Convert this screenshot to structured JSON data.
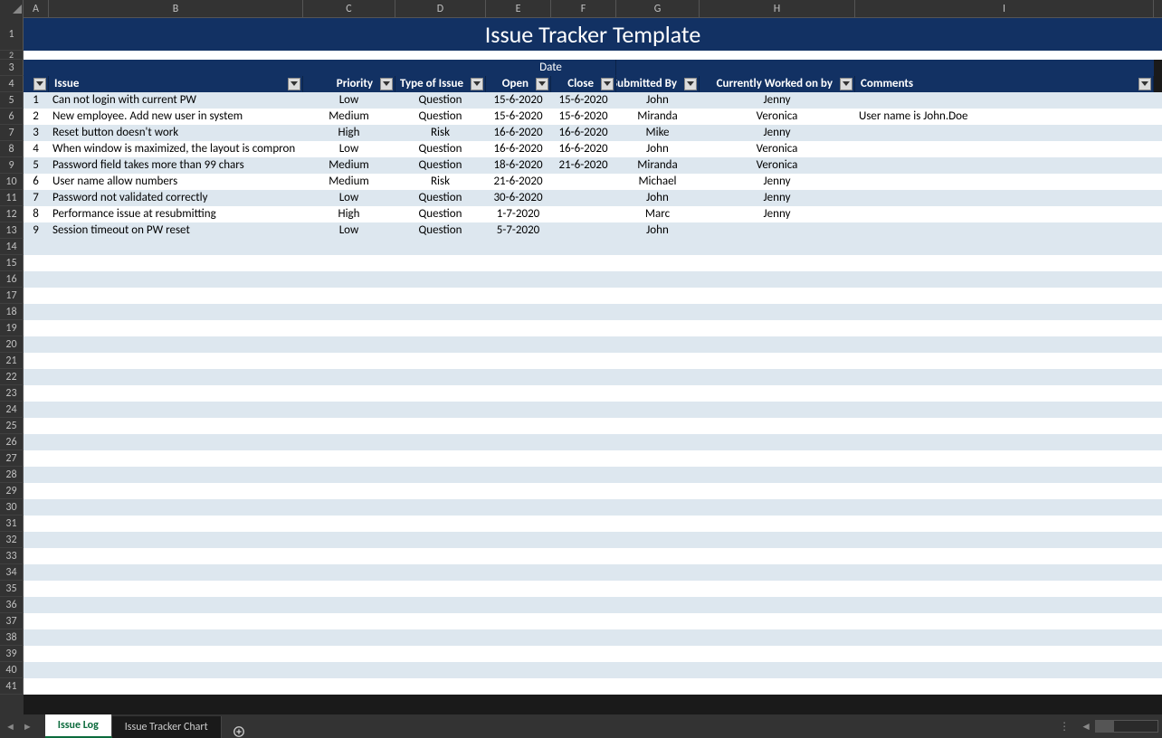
{
  "columns": [
    "A",
    "B",
    "C",
    "D",
    "E",
    "F",
    "G",
    "H",
    "I"
  ],
  "title": "Issue Tracker Template",
  "date_group_label": "Date",
  "headers": {
    "id": "",
    "issue": "Issue",
    "priority": "Priority",
    "type": "Type of Issue",
    "open": "Open",
    "close": "Close",
    "submitted_by": "Submitted By",
    "worked_by": "Currently Worked on by",
    "comments": "Comments"
  },
  "rows": [
    {
      "n": "1",
      "issue": "Can not login with current PW",
      "priority": "Low",
      "type": "Question",
      "open": "15-6-2020",
      "close": "15-6-2020",
      "submitted_by": "John",
      "worked_by": "Jenny",
      "comments": ""
    },
    {
      "n": "2",
      "issue": "New employee. Add new user in system",
      "priority": "Medium",
      "type": "Question",
      "open": "15-6-2020",
      "close": "15-6-2020",
      "submitted_by": "Miranda",
      "worked_by": "Veronica",
      "comments": "User name is John.Doe"
    },
    {
      "n": "3",
      "issue": "Reset button doesn't work",
      "priority": "High",
      "type": "Risk",
      "open": "16-6-2020",
      "close": "16-6-2020",
      "submitted_by": "Mike",
      "worked_by": "Jenny",
      "comments": ""
    },
    {
      "n": "4",
      "issue": "When window is maximized, the layout is compron",
      "priority": "Low",
      "type": "Question",
      "open": "16-6-2020",
      "close": "16-6-2020",
      "submitted_by": "John",
      "worked_by": "Veronica",
      "comments": ""
    },
    {
      "n": "5",
      "issue": "Password field takes more than 99 chars",
      "priority": "Medium",
      "type": "Question",
      "open": "18-6-2020",
      "close": "21-6-2020",
      "submitted_by": "Miranda",
      "worked_by": "Veronica",
      "comments": ""
    },
    {
      "n": "6",
      "issue": "User name allow numbers",
      "priority": "Medium",
      "type": "Risk",
      "open": "21-6-2020",
      "close": "",
      "submitted_by": "Michael",
      "worked_by": "Jenny",
      "comments": ""
    },
    {
      "n": "7",
      "issue": "Password not validated correctly",
      "priority": "Low",
      "type": "Question",
      "open": "30-6-2020",
      "close": "",
      "submitted_by": "John",
      "worked_by": "Jenny",
      "comments": ""
    },
    {
      "n": "8",
      "issue": "Performance issue at resubmitting",
      "priority": "High",
      "type": "Question",
      "open": "1-7-2020",
      "close": "",
      "submitted_by": "Marc",
      "worked_by": "Jenny",
      "comments": ""
    },
    {
      "n": "9",
      "issue": "Session timeout on PW reset",
      "priority": "Low",
      "type": "Question",
      "open": "5-7-2020",
      "close": "",
      "submitted_by": "John",
      "worked_by": "",
      "comments": ""
    }
  ],
  "empty_row_numbers": [
    "14",
    "15",
    "16",
    "17",
    "18",
    "19",
    "20",
    "21",
    "22",
    "23",
    "24",
    "25",
    "26",
    "27",
    "28",
    "29",
    "30",
    "31",
    "32",
    "33",
    "34",
    "35",
    "36",
    "37",
    "38",
    "39",
    "40",
    "41"
  ],
  "tabs": {
    "active": "Issue Log",
    "other": "Issue Tracker Chart"
  }
}
